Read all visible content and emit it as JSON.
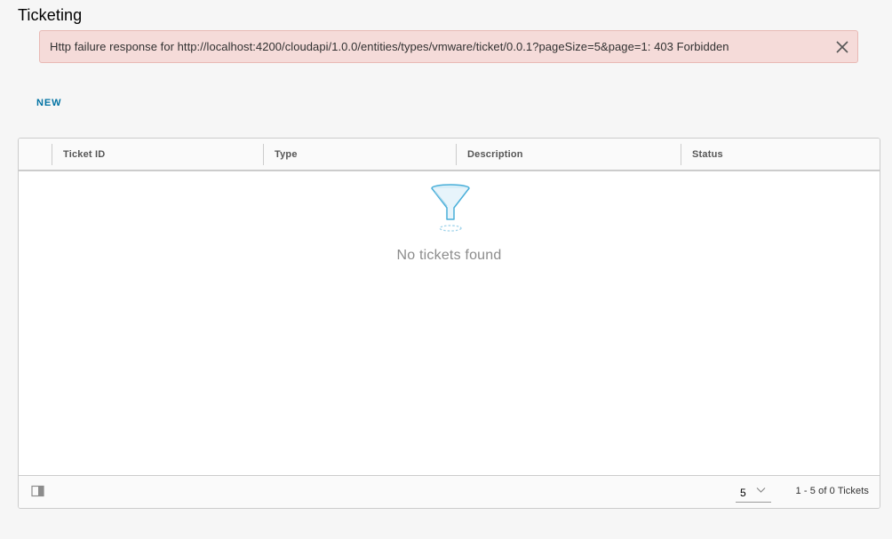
{
  "page": {
    "title": "Ticketing"
  },
  "alert": {
    "message": "Http failure response for http://localhost:4200/cloudapi/1.0.0/entities/types/vmware/ticket/0.0.1?pageSize=5&page=1: 403 Forbidden",
    "type": "danger",
    "close_icon": "close-icon"
  },
  "actions": {
    "new_label": "NEW"
  },
  "grid": {
    "columns": [
      "Ticket ID",
      "Type",
      "Description",
      "Status"
    ],
    "rows": [],
    "empty_text": "No tickets found",
    "empty_icon": "filter-funnel-icon",
    "footer": {
      "column_toggle_icon": "column-switch-icon",
      "page_size": "5",
      "pagination_text": "1 - 5 of 0 Tickets"
    }
  },
  "colors": {
    "alert_background": "#f5dbd9",
    "alert_border": "#e8b9b4",
    "accent": "#0072a3",
    "icon_blue": "#49afd9"
  }
}
